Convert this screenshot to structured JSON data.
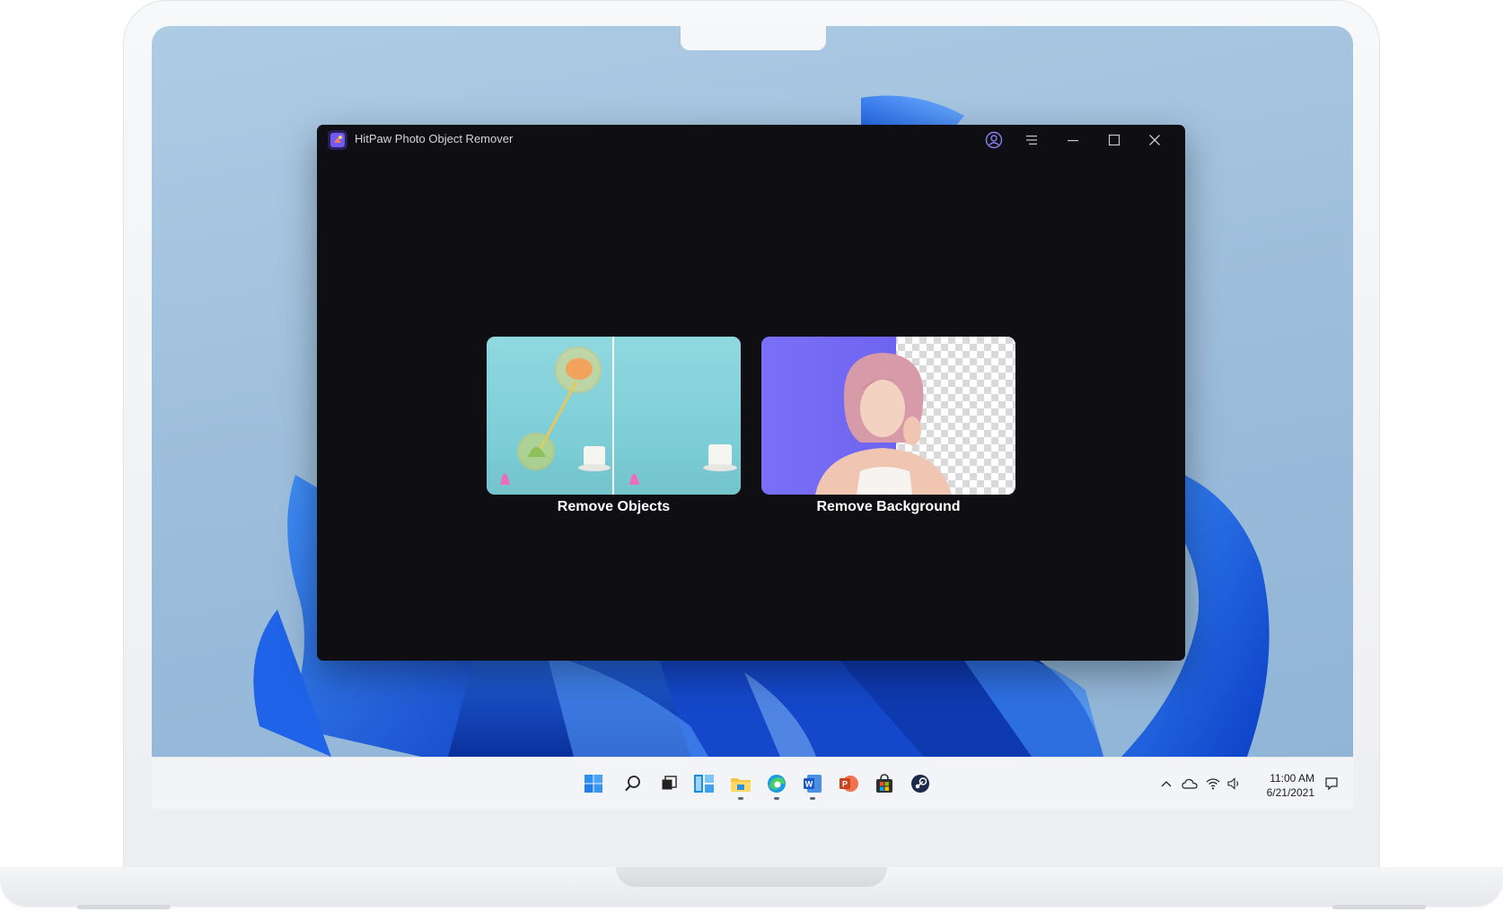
{
  "app": {
    "title": "HitPaw Photo Object Remover"
  },
  "main": {
    "cards": [
      {
        "label": "Remove Objects"
      },
      {
        "label": "Remove Background"
      }
    ]
  },
  "taskbar": {
    "icons": [
      "windows-start-icon",
      "search-icon",
      "task-view-icon",
      "widgets-icon",
      "file-explorer-icon",
      "edge-browser-icon",
      "word-icon",
      "powerpoint-icon",
      "store-icon",
      "steam-icon"
    ],
    "tray_icons": [
      "chevron-up-icon",
      "onedrive-cloud-icon",
      "wifi-icon",
      "volume-icon"
    ],
    "time": "11:00 AM",
    "date": "6/21/2021"
  },
  "colors": {
    "window_bg": "#0e0e13",
    "accent_purple": "#7569f5",
    "wallpaper_blue": "#1a5ae0",
    "screen_sky": "#9dbedc"
  }
}
